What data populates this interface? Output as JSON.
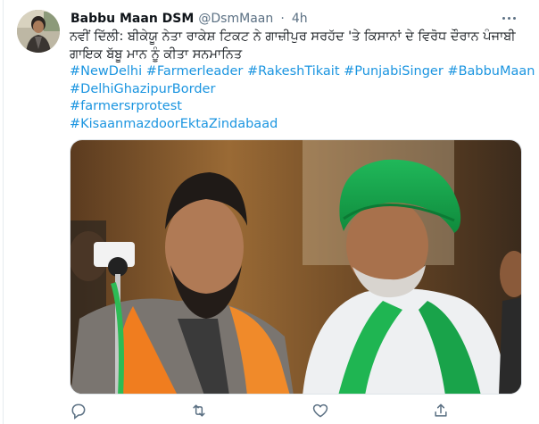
{
  "tweet": {
    "author_name": "Babbu Maan DSM",
    "handle": "@DsmMaan",
    "separator": "·",
    "time": "4h",
    "text_lines": [
      "ਨਵੀਂ ਦਿੱਲੀ: ਬੀਕੇਯੂ ਨੇਤਾ ਰਾਕੇਸ਼ ਟਿਕਟ ਨੇ ਗਾਜ਼ੀਪੁਰ ਸਰਹੱਦ 'ਤੇ ਕਿਸਾਨਾਂ ਦੇ ਵਿਰੋਧ ਦੌਰਾਨ ਪੰਜਾਬੀ",
      "ਗਾਇਕ ਬੱਬੂ ਮਾਨ ਨੂੰ ਕੀਤਾ ਸਨਮਾਨਿਤ"
    ],
    "hashtag_lines": [
      "#NewDelhi #Farmerleader #RakeshTikait #PunjabiSinger #BabbuMaan",
      "#DelhiGhazipurBorder",
      "#farmersrprotest",
      "#KisaanmazdoorEktaZindabaad"
    ]
  },
  "icons": {
    "more": "more-horizontal-icon",
    "reply": "reply-icon",
    "retweet": "retweet-icon",
    "like": "like-icon",
    "share": "share-icon"
  },
  "colors": {
    "accent": "#1b95e0",
    "secondary_text": "#5b7083",
    "turban_green": "#17a34a",
    "scarf_orange": "#f07d1f"
  }
}
